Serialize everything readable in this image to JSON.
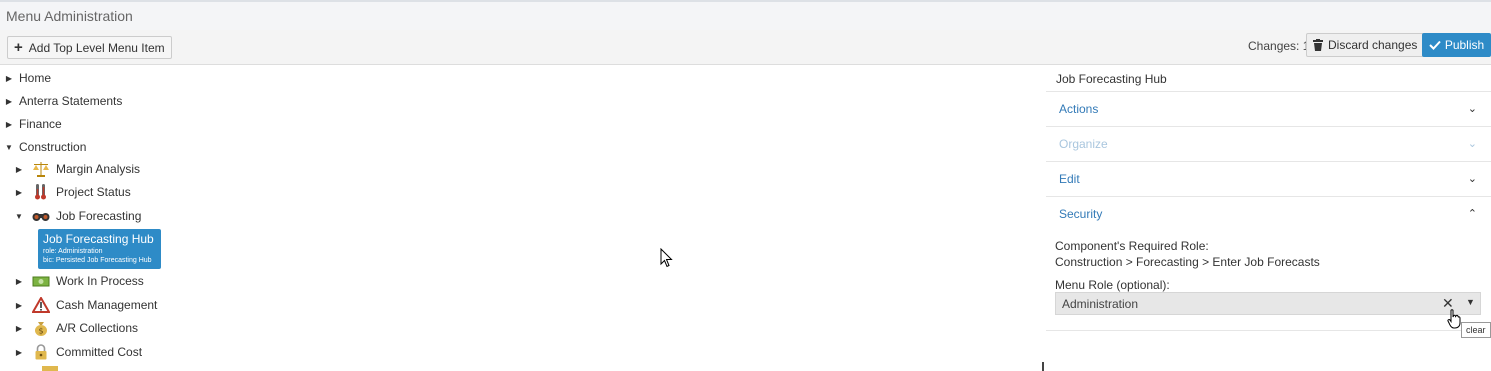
{
  "header": {
    "title": "Menu Administration"
  },
  "toolbar": {
    "add_label": "Add Top Level Menu Item",
    "changes_text": "Changes: 1",
    "discard_label": "Discard changes",
    "publish_label": "Publish"
  },
  "tree": {
    "top": [
      "Home",
      "Anterra Statements",
      "Finance",
      "Construction"
    ],
    "construction_children": [
      "Margin Analysis",
      "Project Status",
      "Job Forecasting"
    ],
    "selected": {
      "title": "Job Forecasting Hub",
      "role": "role: Administration",
      "bic": "bic: Persisted Job Forecasting Hub"
    },
    "after": [
      "Work In Process",
      "Cash Management",
      "A/R Collections",
      "Committed Cost"
    ]
  },
  "panel": {
    "title": "Job Forecasting Hub",
    "sections": [
      "Actions",
      "Organize",
      "Edit",
      "Security"
    ],
    "security": {
      "required_label": "Component's Required Role:",
      "required_value": "Construction > Forecasting > Enter Job Forecasts",
      "menu_role_label": "Menu Role (optional):",
      "menu_role_value": "Administration",
      "clear_tooltip": "clear"
    }
  },
  "colors": {
    "accent": "#2e8bc7",
    "link": "#337ab7"
  }
}
